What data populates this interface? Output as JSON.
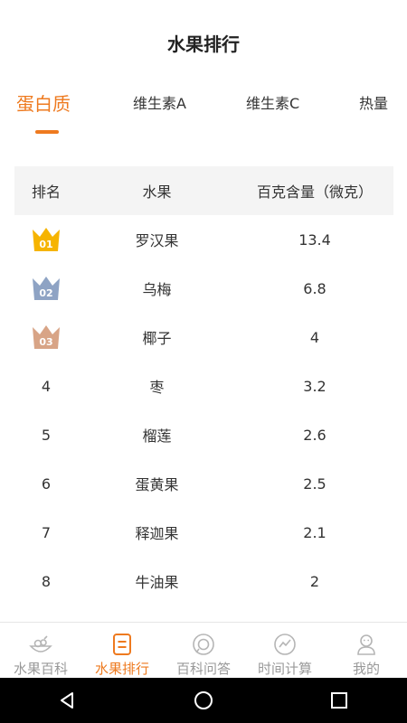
{
  "header": {
    "title": "水果排行"
  },
  "tabs": [
    {
      "label": "蛋白质",
      "active": true
    },
    {
      "label": "维生素A",
      "active": false
    },
    {
      "label": "维生素C",
      "active": false
    },
    {
      "label": "热量",
      "active": false
    }
  ],
  "table": {
    "headers": {
      "rank": "排名",
      "fruit": "水果",
      "amount": "百克含量（微克）"
    },
    "rows": [
      {
        "rank": "01",
        "fruit": "罗汉果",
        "amount": "13.4",
        "badge": "gold"
      },
      {
        "rank": "02",
        "fruit": "乌梅",
        "amount": "6.8",
        "badge": "silver"
      },
      {
        "rank": "03",
        "fruit": "椰子",
        "amount": "4",
        "badge": "bronze"
      },
      {
        "rank": "4",
        "fruit": "枣",
        "amount": "3.2"
      },
      {
        "rank": "5",
        "fruit": "榴莲",
        "amount": "2.6"
      },
      {
        "rank": "6",
        "fruit": "蛋黄果",
        "amount": "2.5"
      },
      {
        "rank": "7",
        "fruit": "释迦果",
        "amount": "2.1"
      },
      {
        "rank": "8",
        "fruit": "牛油果",
        "amount": "2"
      }
    ]
  },
  "bottom_nav": [
    {
      "label": "水果百科",
      "icon": "fruit-bowl-icon",
      "active": false
    },
    {
      "label": "水果排行",
      "icon": "ranking-list-icon",
      "active": true
    },
    {
      "label": "百科问答",
      "icon": "qa-chat-icon",
      "active": false
    },
    {
      "label": "时间计算",
      "icon": "trend-chart-icon",
      "active": false
    },
    {
      "label": "我的",
      "icon": "user-profile-icon",
      "active": false
    }
  ],
  "system_bar": {
    "buttons": [
      "back-icon",
      "home-icon",
      "recents-icon"
    ]
  },
  "colors": {
    "accent": "#ee7a1f",
    "gold": "#f6b400",
    "silver": "#8ea3c4",
    "bronze": "#d8a486",
    "inactive": "#999999"
  }
}
